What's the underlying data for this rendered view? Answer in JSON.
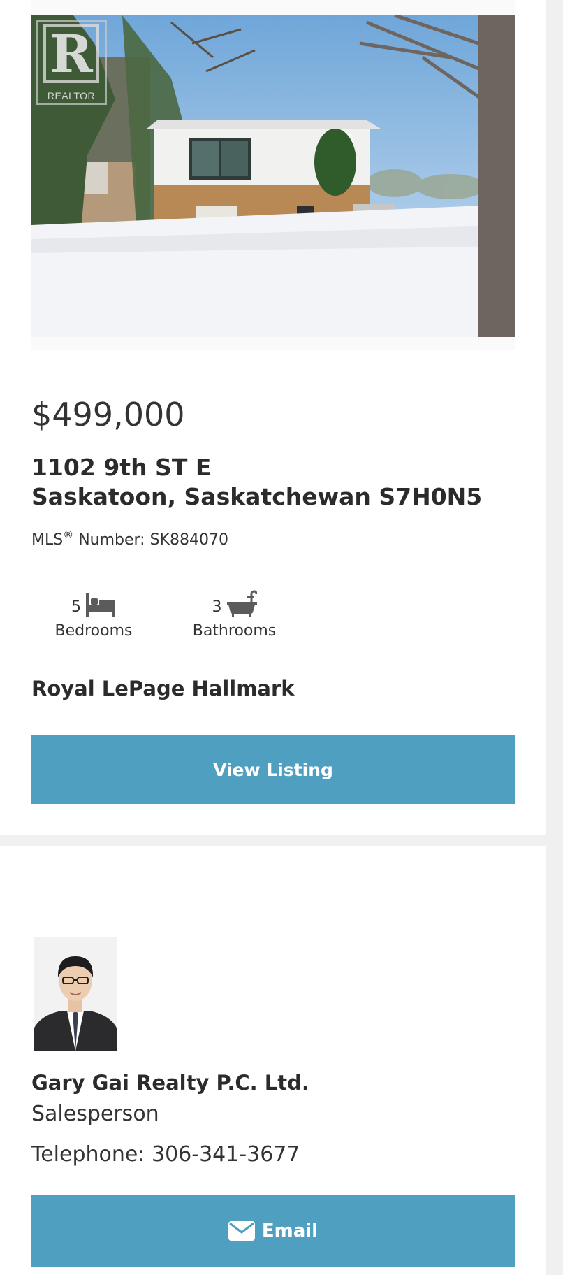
{
  "listing": {
    "photo": {
      "watermark": "REALTOR"
    },
    "price": "$499,000",
    "address_line1": "1102 9th ST E",
    "address_line2": "Saskatoon, Saskatchewan S7H0N5",
    "mls_prefix": "MLS",
    "mls_reg": "®",
    "mls_text": " Number: SK884070",
    "features": [
      {
        "count": "5",
        "label": "Bedrooms",
        "icon": "bed-icon"
      },
      {
        "count": "3",
        "label": "Bathrooms",
        "icon": "bathtub-icon"
      }
    ],
    "office": "Royal LePage Hallmark",
    "view_button": "View Listing"
  },
  "agent": {
    "name": "Gary Gai Realty P.C. Ltd.",
    "role": "Salesperson",
    "phone": "Telephone: 306-341-3677",
    "email_button": "Email",
    "email_icon": "envelope-icon"
  },
  "colors": {
    "button_bg": "#4fa0c0",
    "button_text": "#ffffff",
    "page_bg": "#f0f0f0",
    "card_bg": "#ffffff"
  }
}
